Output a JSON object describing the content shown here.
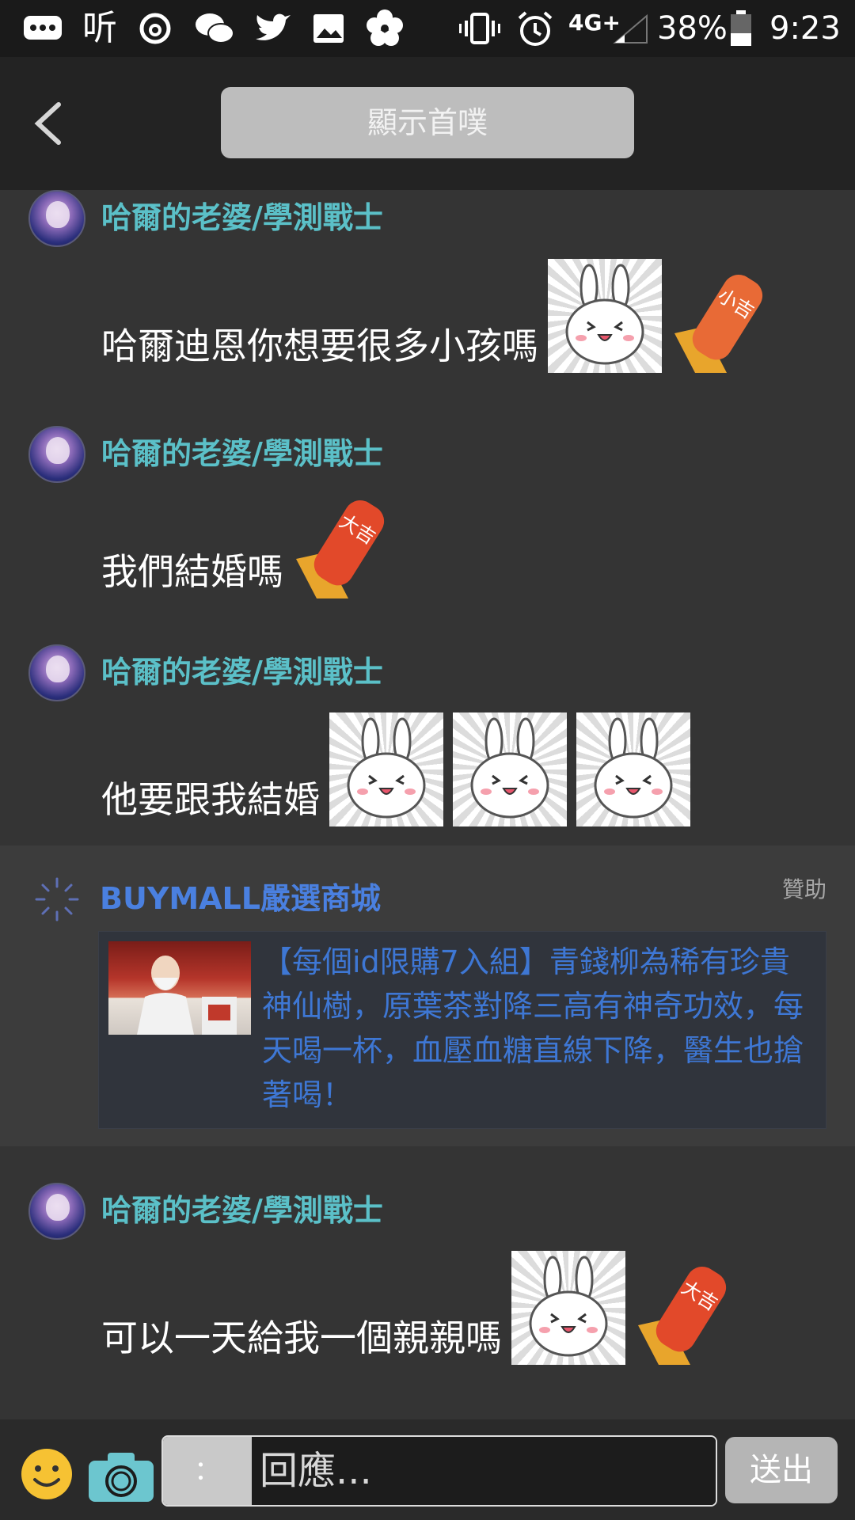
{
  "status_bar": {
    "battery": "38%",
    "time": "9:23",
    "network": "4G+",
    "app_listen_label": "听",
    "icons": [
      "chat-bubble-icon",
      "listen-app-icon",
      "netease-music-icon",
      "wechat-icon",
      "twitter-icon",
      "gallery-icon",
      "flower-icon",
      "vibrate-icon",
      "alarm-icon",
      "signal-icon",
      "battery-icon"
    ]
  },
  "header": {
    "show_first_label": "顯示首噗"
  },
  "messages": [
    {
      "username": "哈爾的老婆/學測戰士",
      "text": "哈爾迪恩你想要很多小孩嗎",
      "stickers": [
        "rabbit-sticker",
        "daikichi-stamp-small"
      ]
    },
    {
      "username": "哈爾的老婆/學測戰士",
      "text": "我們結婚嗎",
      "stickers": [
        "daikichi-stamp-big"
      ]
    },
    {
      "username": "哈爾的老婆/學測戰士",
      "text": "他要跟我結婚",
      "stickers": [
        "rabbit-sticker",
        "rabbit-sticker",
        "rabbit-sticker"
      ]
    },
    {
      "username": "哈爾的老婆/學測戰士",
      "text": "可以一天給我一個親親嗎",
      "stickers": [
        "rabbit-sticker",
        "daikichi-stamp-big"
      ]
    }
  ],
  "ad": {
    "brand": "BUYMALL嚴選商城",
    "sponsor_label": "贊助",
    "text": "【每個id限購7入組】青錢柳為稀有珍貴神仙樹，原葉茶對降三高有神奇功效，每天喝一杯，血壓血糖直線下降，醫生也搶著喝！"
  },
  "input_bar": {
    "prefix": "：",
    "placeholder": "回應...",
    "send_label": "送出"
  },
  "colors": {
    "username": "#5bc0c8",
    "ad_link": "#3e77d4",
    "ad_brand": "#4a80e0",
    "background": "#343434"
  },
  "sticker_labels": {
    "small_stamp": "小吉",
    "big_stamp": "大吉"
  }
}
